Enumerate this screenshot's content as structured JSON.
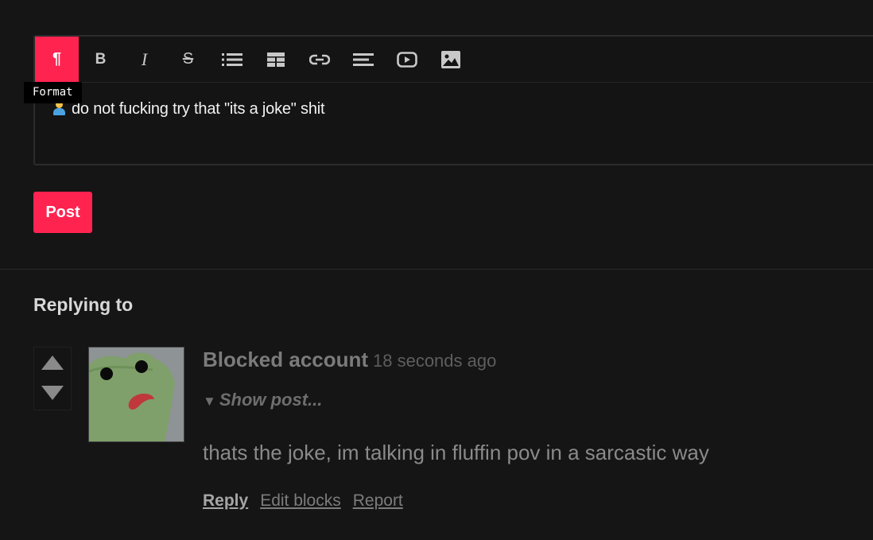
{
  "editor": {
    "toolbar": {
      "buttons": [
        {
          "name": "format",
          "icon": "pilcrow-icon",
          "glyph": "¶",
          "active": true
        },
        {
          "name": "bold",
          "icon": "bold-icon",
          "glyph": "B"
        },
        {
          "name": "italic",
          "icon": "italic-icon",
          "glyph": "I"
        },
        {
          "name": "strikethrough",
          "icon": "strikethrough-icon",
          "glyph": "S"
        },
        {
          "name": "list",
          "icon": "list-icon"
        },
        {
          "name": "table",
          "icon": "table-icon"
        },
        {
          "name": "link",
          "icon": "link-icon"
        },
        {
          "name": "align",
          "icon": "align-left-icon"
        },
        {
          "name": "video",
          "icon": "youtube-icon"
        },
        {
          "name": "image",
          "icon": "image-icon"
        }
      ]
    },
    "tooltip": "Format",
    "content_text": "do not fucking try that \"its a joke\" shit"
  },
  "post_button_label": "Post",
  "replying_section": {
    "title": "Replying to",
    "comment": {
      "author": "Blocked account",
      "timestamp": "18 seconds ago",
      "show_post_label": "Show post...",
      "text": "thats the joke, im talking in fluffin pov in a sarcastic way",
      "actions": {
        "reply": "Reply",
        "edit_blocks": "Edit blocks",
        "report": "Report"
      }
    }
  },
  "colors": {
    "accent": "#ff2350",
    "background": "#151515"
  }
}
